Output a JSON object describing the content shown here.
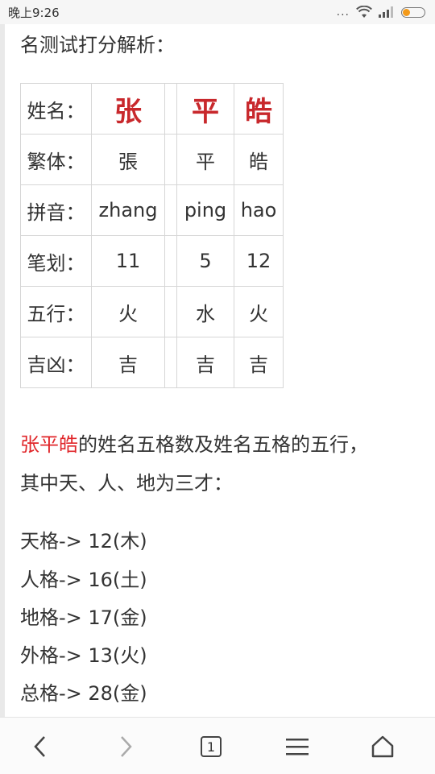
{
  "status_bar": {
    "time": "晚上9:26",
    "dots": "...",
    "battery_color": "#f39a1a"
  },
  "article": {
    "heading": "名测试打分解析：",
    "table": {
      "rows": [
        {
          "label": "姓名：",
          "cells": [
            "张",
            "",
            "平",
            "皓"
          ]
        },
        {
          "label": "繁体：",
          "cells": [
            "張",
            "",
            "平",
            "皓"
          ]
        },
        {
          "label": "拼音：",
          "cells": [
            "zhang",
            "",
            "ping",
            "hao"
          ]
        },
        {
          "label": "笔划：",
          "cells": [
            "11",
            "",
            "5",
            "12"
          ]
        },
        {
          "label": "五行：",
          "cells": [
            "火",
            "",
            "水",
            "火"
          ]
        },
        {
          "label": "吉凶：",
          "cells": [
            "吉",
            "",
            "吉",
            "吉"
          ]
        }
      ]
    },
    "intro_name": "张平皓",
    "intro_line1_rest": "的姓名五格数及姓名五格的五行，",
    "intro_line2": "其中天、人、地为三才：",
    "grids": [
      "天格-> 12(木)",
      "人格-> 16(土)",
      "地格-> 17(金)",
      "外格-> 13(火)",
      "总格-> 28(金)"
    ],
    "accent_color": "#c8282c"
  },
  "bottom_nav": {
    "tab_count": "1",
    "icons": [
      "back-chevron-icon",
      "forward-chevron-icon",
      "tabs-icon",
      "menu-icon",
      "home-icon"
    ]
  }
}
